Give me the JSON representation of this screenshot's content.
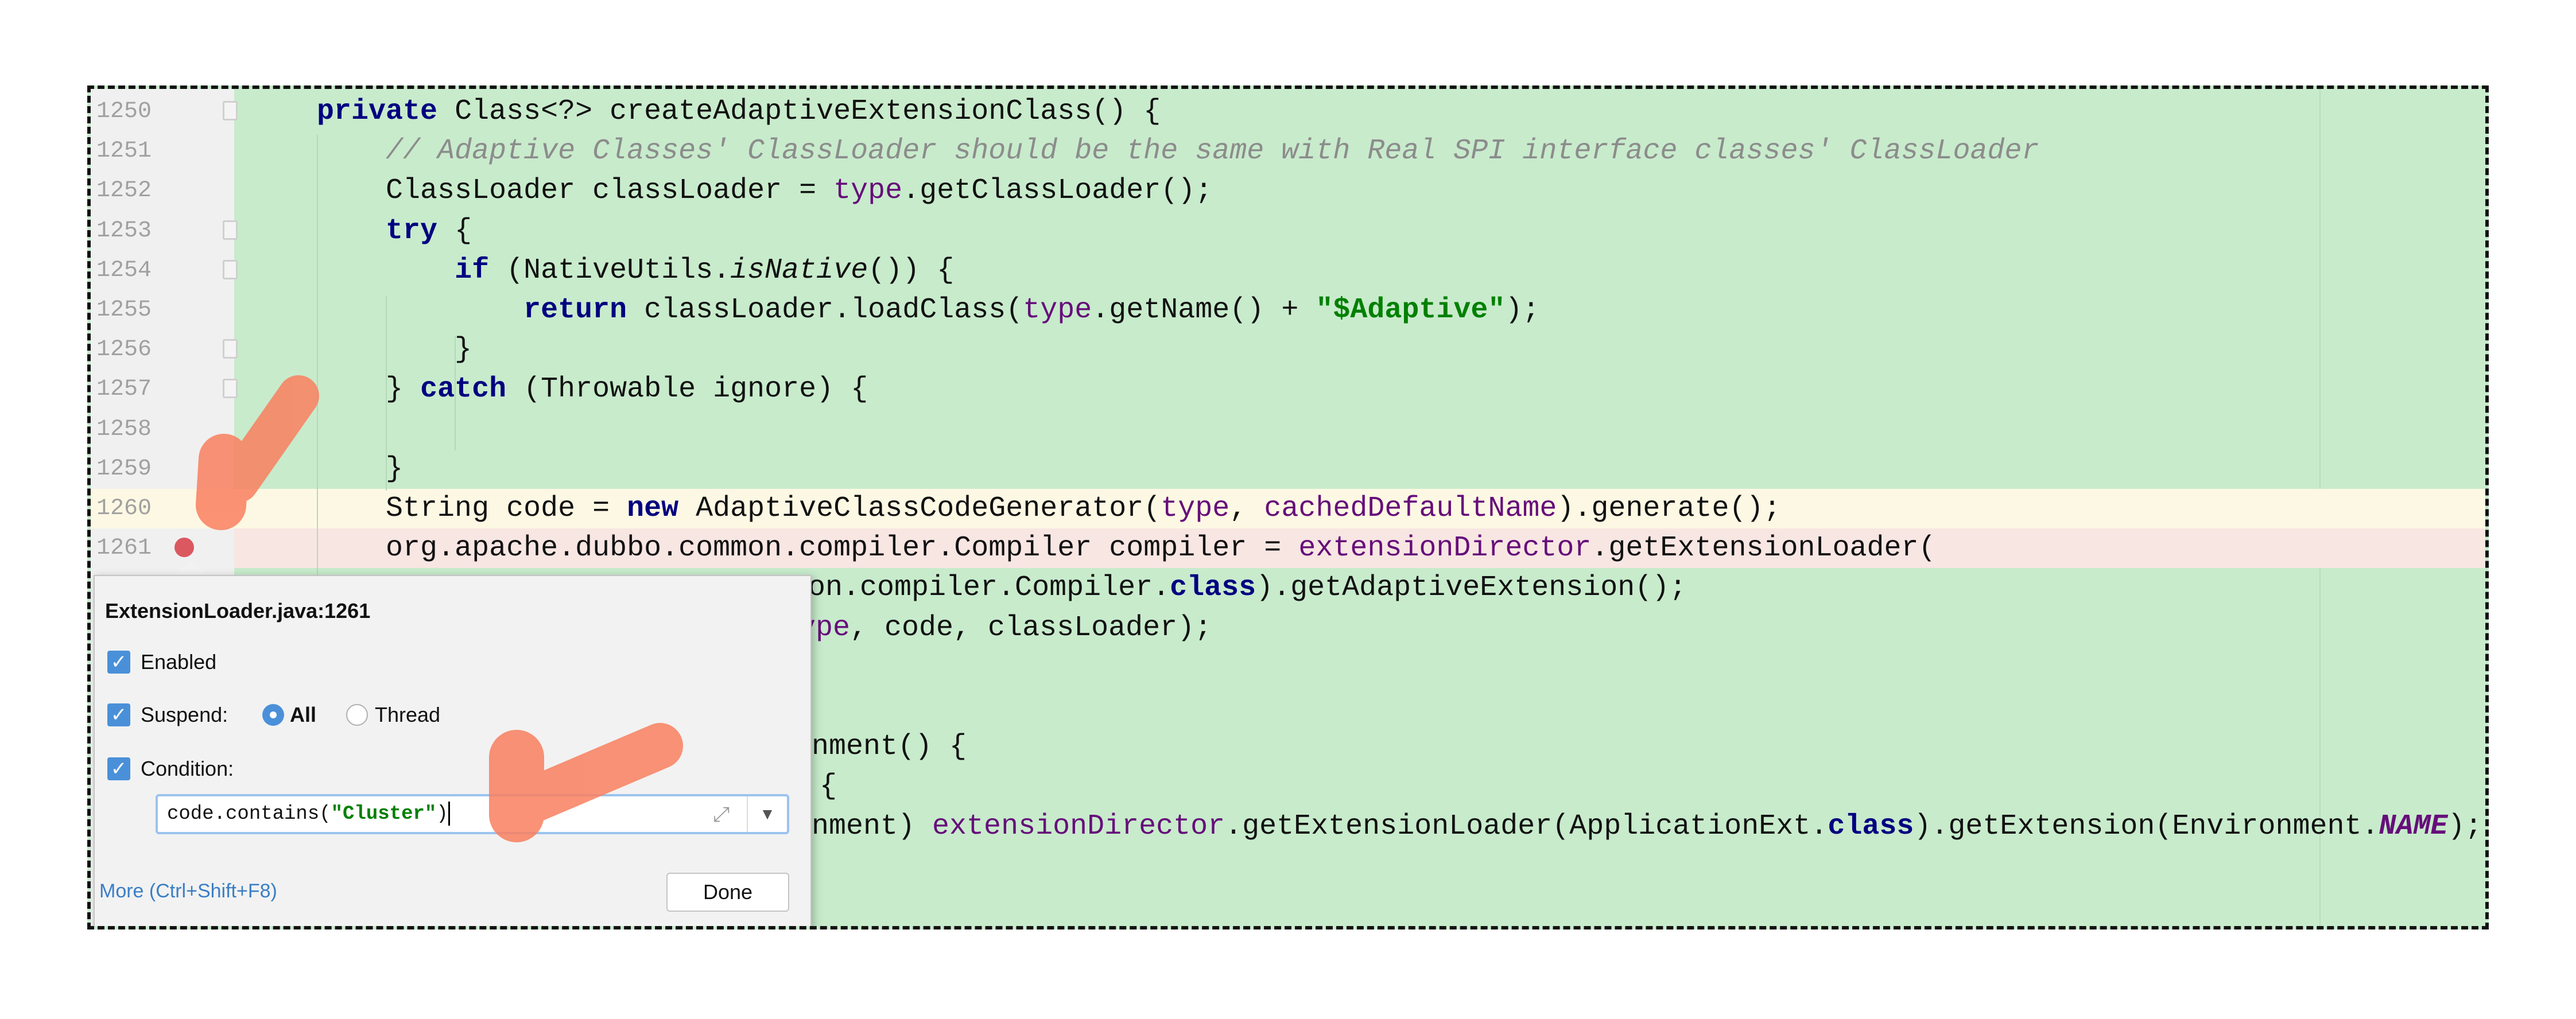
{
  "editor": {
    "lines": [
      {
        "num": "1250",
        "tokens": [
          {
            "t": "    "
          },
          {
            "t": "private",
            "c": "kw"
          },
          {
            "t": " Class<?> createAdaptiveExtensionClass() {"
          }
        ]
      },
      {
        "num": "1251",
        "tokens": [
          {
            "t": "        "
          },
          {
            "t": "// Adaptive Classes' ClassLoader should be the same with Real SPI interface classes' ClassLoader",
            "c": "cm"
          }
        ]
      },
      {
        "num": "1252",
        "tokens": [
          {
            "t": "        ClassLoader classLoader = "
          },
          {
            "t": "type",
            "c": "fld"
          },
          {
            "t": ".getClassLoader();"
          }
        ]
      },
      {
        "num": "1253",
        "tokens": [
          {
            "t": "        "
          },
          {
            "t": "try",
            "c": "kw"
          },
          {
            "t": " {"
          }
        ]
      },
      {
        "num": "1254",
        "tokens": [
          {
            "t": "            "
          },
          {
            "t": "if",
            "c": "kw"
          },
          {
            "t": " (NativeUtils."
          },
          {
            "t": "isNative",
            "c": "it"
          },
          {
            "t": "()) {"
          }
        ]
      },
      {
        "num": "1255",
        "tokens": [
          {
            "t": "                "
          },
          {
            "t": "return",
            "c": "kw"
          },
          {
            "t": " classLoader.loadClass("
          },
          {
            "t": "type",
            "c": "fld"
          },
          {
            "t": ".getName() + "
          },
          {
            "t": "\"$Adaptive\"",
            "c": "str"
          },
          {
            "t": ");"
          }
        ]
      },
      {
        "num": "1256",
        "tokens": [
          {
            "t": "            }"
          }
        ]
      },
      {
        "num": "1257",
        "tokens": [
          {
            "t": "        } "
          },
          {
            "t": "catch",
            "c": "kw"
          },
          {
            "t": " (Throwable ignore) {"
          }
        ]
      },
      {
        "num": "1258",
        "tokens": []
      },
      {
        "num": "1259",
        "tokens": [
          {
            "t": "        }"
          }
        ]
      },
      {
        "num": "1260",
        "tokens": [
          {
            "t": "        String code = "
          },
          {
            "t": "new",
            "c": "kw"
          },
          {
            "t": " AdaptiveClassCodeGenerator("
          },
          {
            "t": "type",
            "c": "fld"
          },
          {
            "t": ", "
          },
          {
            "t": "cachedDefaultName",
            "c": "fld"
          },
          {
            "t": ").generate();"
          }
        ]
      },
      {
        "num": "1261",
        "tokens": [
          {
            "t": "        org.apache.dubbo.common.compiler.Compiler compiler = "
          },
          {
            "t": "extensionDirector",
            "c": "fld"
          },
          {
            "t": ".getExtensionLoader("
          }
        ]
      }
    ],
    "partial_lines": [
      {
        "tokens": [
          {
            "t": "on.compiler.Compiler."
          },
          {
            "t": "class",
            "c": "kw"
          },
          {
            "t": ").getAdaptiveExtension();"
          }
        ]
      },
      {
        "tokens": [
          {
            "t": "ype",
            "c": "fld"
          },
          {
            "t": ", code, classLoader);"
          }
        ]
      },
      {
        "tokens": []
      },
      {
        "tokens": []
      },
      {
        "tokens": [
          {
            "t": "nment() {"
          }
        ]
      },
      {
        "tokens": [
          {
            "t": "{"
          }
        ]
      },
      {
        "tokens": [
          {
            "t": "nment) "
          },
          {
            "t": "extensionDirector",
            "c": "fld"
          },
          {
            "t": ".getExtensionLoader(ApplicationExt."
          },
          {
            "t": "class",
            "c": "kw"
          },
          {
            "t": ").getExtension(Environment."
          },
          {
            "t": "NAME",
            "c": "cnst"
          },
          {
            "t": ");"
          }
        ]
      },
      {
        "tokens": []
      },
      {
        "tokens": []
      }
    ],
    "breakpoint_line": "1261",
    "colors": {
      "background": "#c8ebcc",
      "current_line": "#fdf8e3",
      "breakpoint_line": "#f8e6e3",
      "breakpoint": "#db5860",
      "annotation_arrow": "#f9805f"
    }
  },
  "breakpoint_popup": {
    "title": "ExtensionLoader.java:1261",
    "enabled": {
      "label": "Enabled",
      "checked": true
    },
    "suspend": {
      "label": "Suspend:",
      "checked": true,
      "options": [
        {
          "label": "All",
          "selected": true
        },
        {
          "label": "Thread",
          "selected": false
        }
      ]
    },
    "condition": {
      "label": "Condition:",
      "checked": true,
      "value_prefix": "code.contains(",
      "value_string": "\"Cluster\"",
      "value_suffix": ")"
    },
    "more_link": "More (Ctrl+Shift+F8)",
    "done_button": "Done",
    "icons": {
      "expand": "expand-icon",
      "dropdown": "chevron-down-icon",
      "check": "checkmark-icon"
    }
  }
}
